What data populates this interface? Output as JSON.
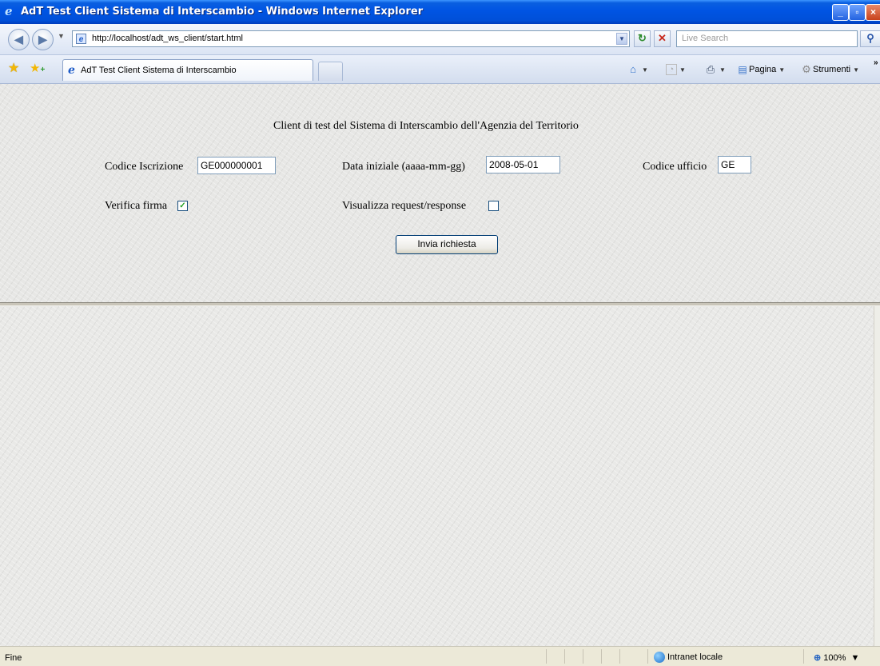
{
  "window": {
    "title": "AdT Test Client Sistema di Interscambio - Windows Internet Explorer",
    "app_icon": "ie-logo-icon",
    "buttons": {
      "minimize": "_",
      "maximize": "▫",
      "close": "×"
    }
  },
  "address_bar": {
    "url": "http://localhost/adt_ws_client/start.html",
    "search_placeholder": "Live Search"
  },
  "tabs": [
    {
      "label": "AdT Test Client Sistema di Interscambio"
    }
  ],
  "command_bar": {
    "page_label": "Pagina",
    "tools_label": "Strumenti"
  },
  "form": {
    "heading": "Client di test del Sistema di Interscambio dell'Agenzia del Territorio",
    "codice_iscrizione": {
      "label": "Codice Iscrizione",
      "value": "GE000000001"
    },
    "data_iniziale": {
      "label": "Data iniziale (aaaa-mm-gg)",
      "value": "2008-05-01"
    },
    "codice_ufficio": {
      "label": "Codice ufficio",
      "value": "GE"
    },
    "verifica_firma": {
      "label": "Verifica firma",
      "checked": true
    },
    "visualizza": {
      "label": "Visualizza request/response",
      "checked": false
    },
    "submit_label": "Invia richiesta"
  },
  "status_bar": {
    "text": "Fine",
    "zone": "Intranet locale",
    "zoom": "100%"
  },
  "colors": {
    "titlebar": "#0054e3",
    "page_background": "#e7e7e5",
    "chrome": "#ece9d8"
  }
}
